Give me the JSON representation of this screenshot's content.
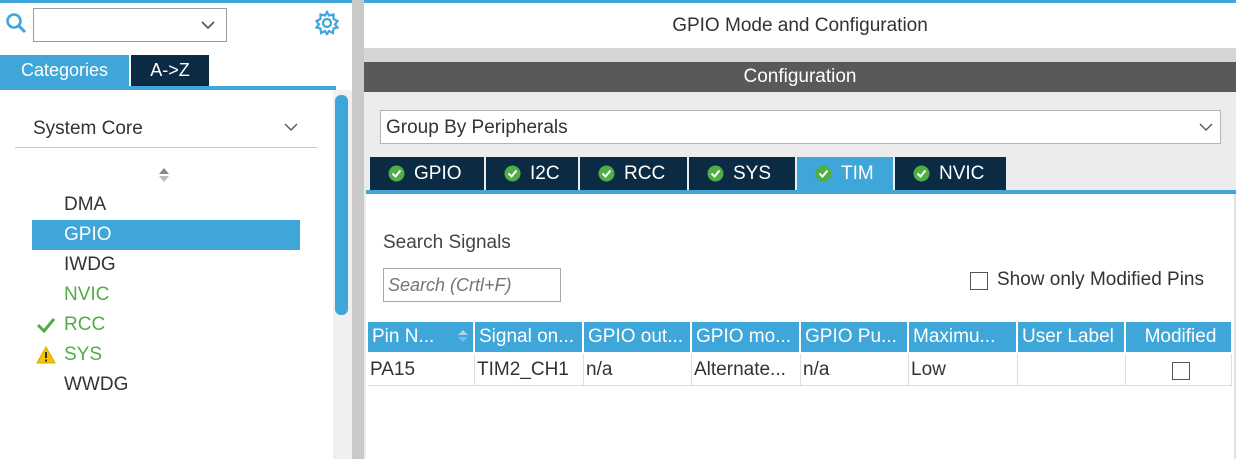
{
  "left_panel": {
    "search": {
      "value": ""
    },
    "tabs": {
      "categories": "Categories",
      "az": "A->Z"
    },
    "category_select": "System Core",
    "items": [
      {
        "label": "DMA",
        "state": "none"
      },
      {
        "label": "GPIO",
        "state": "selected"
      },
      {
        "label": "IWDG",
        "state": "none"
      },
      {
        "label": "NVIC",
        "state": "configured"
      },
      {
        "label": "RCC",
        "state": "ok"
      },
      {
        "label": "SYS",
        "state": "warning"
      },
      {
        "label": "WWDG",
        "state": "none"
      }
    ]
  },
  "right_panel": {
    "title": "GPIO Mode and Configuration",
    "config_header": "Configuration",
    "group_select": "Group By Peripherals",
    "tabs": [
      {
        "label": "GPIO",
        "active": false
      },
      {
        "label": "I2C",
        "active": false
      },
      {
        "label": "RCC",
        "active": false
      },
      {
        "label": "SYS",
        "active": false
      },
      {
        "label": "TIM",
        "active": true
      },
      {
        "label": "NVIC",
        "active": false
      }
    ],
    "search_signals_label": "Search Signals",
    "search_signals_placeholder": "Search (Crtl+F)",
    "show_modified_label": "Show only Modified Pins",
    "table": {
      "columns": [
        "Pin N...",
        "Signal on...",
        "GPIO out...",
        "GPIO mo...",
        "GPIO Pu...",
        "Maximu...",
        "User Label",
        "Modified"
      ],
      "rows": [
        [
          "PA15",
          "TIM2_CH1",
          "n/a",
          "Alternate...",
          "n/a",
          "Low",
          "",
          ""
        ]
      ]
    }
  },
  "colors": {
    "accent": "#3ea6d8",
    "dark_tab": "#0b2a44",
    "config_header": "#595959",
    "ok_green": "#4fae45",
    "warning_yellow": "#f5c400"
  }
}
